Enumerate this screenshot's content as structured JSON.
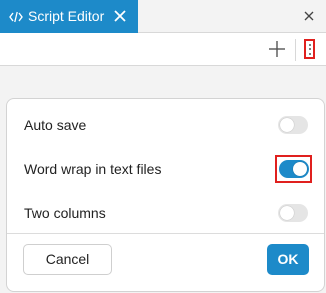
{
  "window": {
    "tab_title": "Script Editor",
    "tab_icon": "code-icon",
    "tab_close_icon": "close-icon",
    "window_close_icon": "close-icon"
  },
  "toolbar": {
    "add_icon": "plus-icon",
    "menu_icon": "kebab-menu-icon"
  },
  "settings": {
    "items": [
      {
        "label": "Auto save",
        "enabled": false
      },
      {
        "label": "Word wrap in text files",
        "enabled": true
      },
      {
        "label": "Two columns",
        "enabled": false
      }
    ]
  },
  "buttons": {
    "cancel": "Cancel",
    "ok": "OK"
  },
  "colors": {
    "accent": "#1d8ac9",
    "highlight": "#e0201e"
  }
}
